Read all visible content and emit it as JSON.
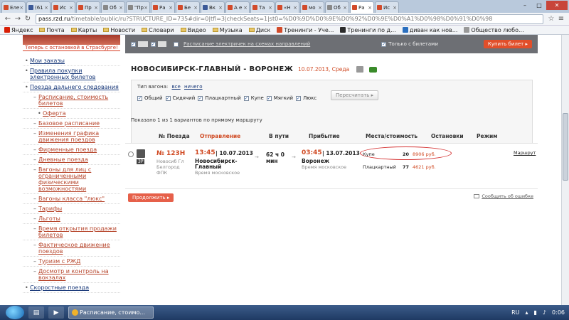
{
  "browser": {
    "tabs": [
      {
        "label": "Еле",
        "color": "#d24a2a"
      },
      {
        "label": "(61",
        "color": "#3b5998"
      },
      {
        "label": "Ис",
        "color": "#d24a2a"
      },
      {
        "label": "Пр",
        "color": "#d24a2a"
      },
      {
        "label": "Об",
        "color": "#888888"
      },
      {
        "label": "\"Пр",
        "color": "#888888"
      },
      {
        "label": "Ра",
        "color": "#d24a2a"
      },
      {
        "label": "Бе",
        "color": "#d24a2a"
      },
      {
        "label": "Вк",
        "color": "#3b5998"
      },
      {
        "label": "А е",
        "color": "#d24a2a"
      },
      {
        "label": "Та",
        "color": "#d24a2a"
      },
      {
        "label": "«Н",
        "color": "#d24a2a"
      },
      {
        "label": "мо",
        "color": "#d24a2a"
      },
      {
        "label": "Об",
        "color": "#888888"
      },
      {
        "label": "Ра",
        "color": "#d24a2a"
      },
      {
        "label": "Ис",
        "color": "#d24a2a"
      }
    ],
    "active_tab_index": 14,
    "url_host": "pass.rzd.ru",
    "url_rest": "/timetable/public/ru?STRUCTURE_ID=735#dir=0|tfl=3|checkSeats=1|st0=%D0%9D%D0%9E%D0%92%D0%9E%D0%A1%D0%98%D0%91%D0%98",
    "bookmarks": [
      {
        "label": "Яндекс",
        "kind": "site",
        "color": "#d81e05"
      },
      {
        "label": "Почта",
        "kind": "folder"
      },
      {
        "label": "Карты",
        "kind": "folder"
      },
      {
        "label": "Новости",
        "kind": "folder"
      },
      {
        "label": "Словари",
        "kind": "folder"
      },
      {
        "label": "Видео",
        "kind": "folder"
      },
      {
        "label": "Музыка",
        "kind": "folder"
      },
      {
        "label": "Диск",
        "kind": "folder"
      },
      {
        "label": "Тренинги - Уче...",
        "kind": "site",
        "color": "#d24a2a"
      },
      {
        "label": "Тренинги по д...",
        "kind": "site",
        "color": "#2b2b2b"
      },
      {
        "label": "диван как нов...",
        "kind": "site",
        "color": "#2a6fbf"
      },
      {
        "label": "Общество любо...",
        "kind": "site",
        "color": "#999999"
      }
    ]
  },
  "promo": {
    "text": "Теперь с остановкой в Страсбурге!"
  },
  "sidebar": {
    "items": [
      {
        "label": "Мои заказы",
        "level": 0
      },
      {
        "label": "Правила покупки электронных билетов",
        "level": 0
      },
      {
        "label": "Поезда дальнего следования",
        "level": 0
      },
      {
        "label": "Расписание, стоимость билетов",
        "level": 1
      },
      {
        "label": "Оферта",
        "level": 2
      },
      {
        "label": "Базовое расписание",
        "level": 1
      },
      {
        "label": "Изменения графика движения поездов",
        "level": 1
      },
      {
        "label": "Фирменные поезда",
        "level": 1
      },
      {
        "label": "Дневные поезда",
        "level": 1
      },
      {
        "label": "Вагоны для лиц с ограниченными физическими возможностями",
        "level": 1
      },
      {
        "label": "Вагоны класса \"люкс\"",
        "level": 1
      },
      {
        "label": "Тарифы",
        "level": 1
      },
      {
        "label": "Льготы",
        "level": 1
      },
      {
        "label": "Время открытия продажи билетов",
        "level": 1
      },
      {
        "label": "Фактическое движение поездов",
        "level": 1
      },
      {
        "label": "Туризм с РЖД",
        "level": 1
      },
      {
        "label": "Досмотр и контроль на вокзалах",
        "level": 1
      },
      {
        "label": "Скоростные поезда",
        "level": 0
      }
    ]
  },
  "topbar": {
    "schedule_link": "Расписание электричек на схемах направлений",
    "only_tickets": "Только с билетами",
    "buy_label": "Купить билет"
  },
  "route": {
    "name": "НОВОСИБИРСК-ГЛАВНЫЙ - ВОРОНЕЖ",
    "date": "10.07.2013, Среда"
  },
  "filter": {
    "title": "Тип вагона:",
    "all": "все",
    "none": "ничего",
    "wagons": [
      "Общий",
      "Сидячий",
      "Плацкартный",
      "Купе",
      "Мягкий",
      "Люкс"
    ],
    "recount_label": "Пересчитать"
  },
  "shown_text": "Показано 1 из 1 вариантов по прямому маршруту",
  "table": {
    "headers": {
      "train": "№ Поезда",
      "departure": "Отправление",
      "duration": "В пути",
      "arrival": "Прибытие",
      "seats": "Места/стоимость",
      "stops": "Остановки",
      "mode": "Режим"
    },
    "row": {
      "badge": "3Р",
      "number": "№ 123Н",
      "route1": "Новосиб Гл",
      "route2": "Белгород",
      "carrier": "ФПК",
      "dep_time": "13:45",
      "dep_date": "| 10.07.2013",
      "dep_station1": "Новосибирск-",
      "dep_station2": "Главный",
      "dep_tz": "Время московское",
      "duration1": "62 ч 0",
      "duration2": "мин",
      "arr_time": "03:45",
      "arr_date": "| 13.07.2013",
      "arr_station": "Воронеж",
      "arr_tz": "Время московское",
      "seats": [
        {
          "type": "Купе",
          "count": "20",
          "price": "8906 руб."
        },
        {
          "type": "Плацкартный",
          "count": "77",
          "price": "4621 руб."
        }
      ],
      "route_link": "Маршрут"
    }
  },
  "continue_label": "Продолжить",
  "report_label": "Сообщить об ошибке",
  "taskbar": {
    "task_label": "Расписание, стоимо...",
    "lang": "RU",
    "time": "0:06"
  }
}
